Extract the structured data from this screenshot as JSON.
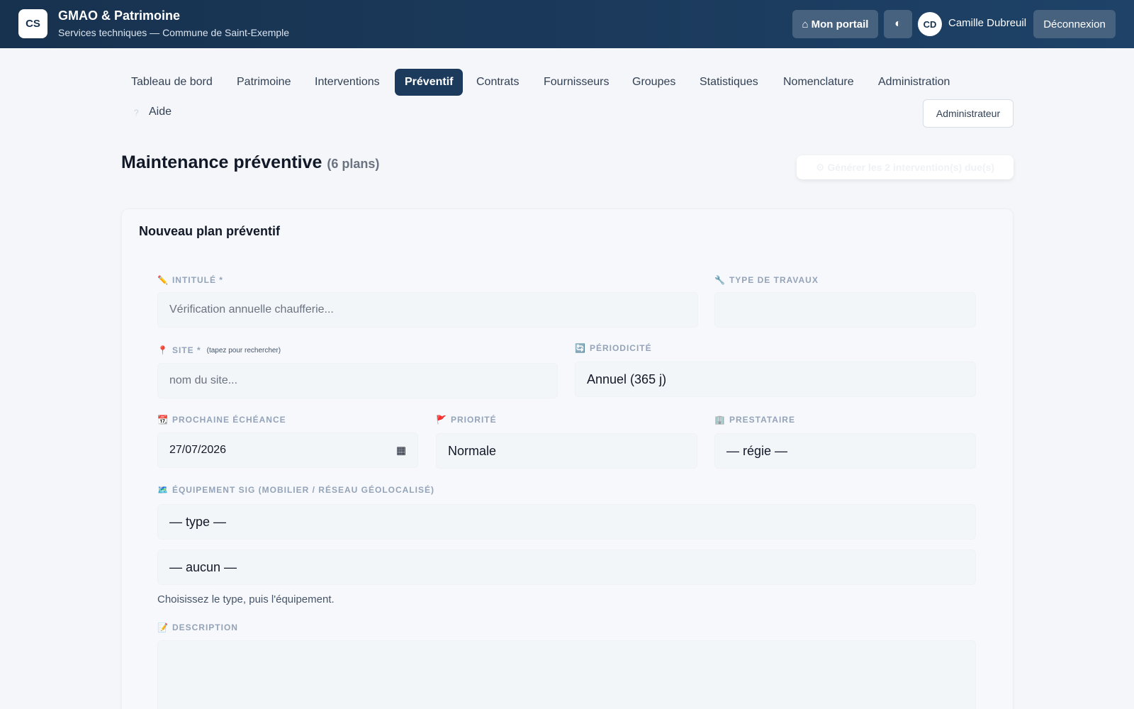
{
  "header": {
    "logo": "CS",
    "title": "GMAO & Patrimoine",
    "subtitle": "Services techniques — Commune de Saint-Exemple",
    "portal_icon": "⌂",
    "portal_label": "Mon portail",
    "theme_icon": "◐",
    "user_initials": "CD",
    "user_name": "Camille Dubreuil",
    "logout_label": "Déconnexion"
  },
  "nav": {
    "items": [
      {
        "label": "Tableau de bord"
      },
      {
        "label": "Patrimoine"
      },
      {
        "label": "Interventions"
      },
      {
        "label": "Préventif",
        "active": true
      },
      {
        "label": "Contrats"
      },
      {
        "label": "Fournisseurs"
      },
      {
        "label": "Groupes"
      },
      {
        "label": "Statistiques"
      },
      {
        "label": "Nomenclature"
      },
      {
        "label": "Administration"
      }
    ],
    "help_icon": "?",
    "help_label": "Aide",
    "role_label": "Administrateur"
  },
  "page": {
    "title": "Maintenance préventive",
    "count": "(6 plans)",
    "generate_label": "⚙ Générer les 2 intervention(s) due(s)"
  },
  "form": {
    "title": "Nouveau plan préventif",
    "intitule": {
      "icon": "✏️",
      "label": "INTITULÉ *",
      "placeholder": "Vérification annuelle chaufferie..."
    },
    "type_travaux": {
      "icon": "🔧",
      "label": "TYPE DE TRAVAUX",
      "value": ""
    },
    "site": {
      "icon": "📍",
      "label": "SITE *",
      "hint": "(tapez pour rechercher)",
      "placeholder": "nom du site..."
    },
    "periodicite": {
      "icon": "🔄",
      "label": "PÉRIODICITÉ",
      "value": "Annuel (365 j)"
    },
    "echeance": {
      "icon": "📆",
      "label": "PROCHAINE ÉCHÉANCE",
      "value": "27/07/2026",
      "cal_icon": "▦"
    },
    "priorite": {
      "icon": "🚩",
      "label": "PRIORITÉ",
      "value": "Normale"
    },
    "prestataire": {
      "icon": "🏢",
      "label": "PRESTATAIRE",
      "value": "— régie —"
    },
    "equipement": {
      "icon": "🗺️",
      "label": "ÉQUIPEMENT SIG (MOBILIER / RÉSEAU GÉOLOCALISÉ)",
      "type_value": "— type —",
      "item_value": "— aucun —",
      "help": "Choisissez le type, puis l'équipement."
    },
    "description": {
      "icon": "📝",
      "label": "DESCRIPTION"
    }
  }
}
